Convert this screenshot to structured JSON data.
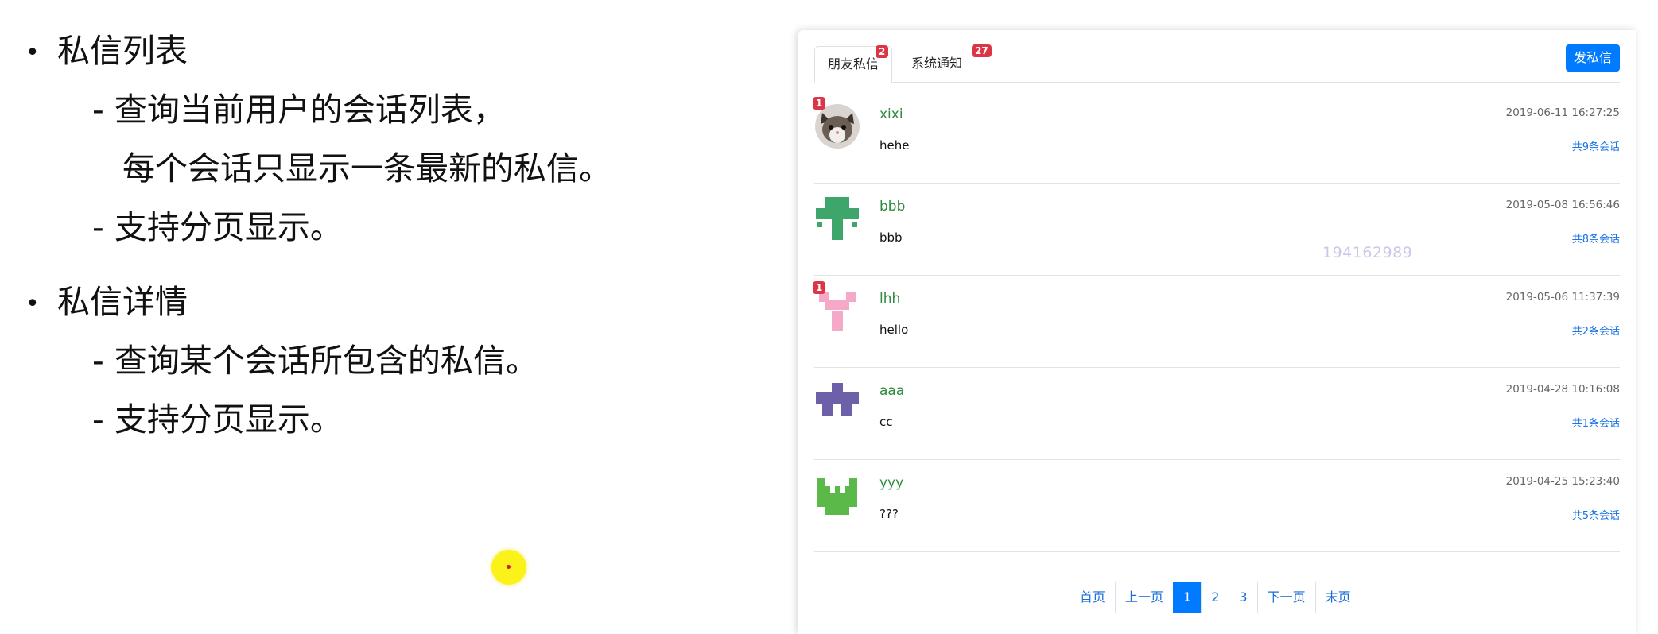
{
  "slide": {
    "items": [
      {
        "bullet": "•",
        "title": "私信列表",
        "subs": [
          "- 查询当前用户的会话列表，",
          "每个会话只显示一条最新的私信。",
          "- 支持分页显示。"
        ]
      },
      {
        "bullet": "•",
        "title": "私信详情",
        "subs": [
          "- 查询某个会话所包含的私信。",
          "- 支持分页显示。"
        ]
      }
    ]
  },
  "panel": {
    "tabs": [
      {
        "label": "朋友私信",
        "badge": "2"
      },
      {
        "label": "系统通知",
        "badge": "27"
      }
    ],
    "send_button": "发私信",
    "watermark": "194162989",
    "conversations": [
      {
        "user": "xixi",
        "message": "hehe",
        "time": "2019-06-11 16:27:25",
        "count": "共9条会话",
        "unread": "1",
        "avatar": "cat-photo"
      },
      {
        "user": "bbb",
        "message": "bbb",
        "time": "2019-05-08 16:56:46",
        "count": "共8条会话",
        "unread": "",
        "avatar": "identicon-green"
      },
      {
        "user": "lhh",
        "message": "hello",
        "time": "2019-05-06 11:37:39",
        "count": "共2条会话",
        "unread": "1",
        "avatar": "identicon-pink"
      },
      {
        "user": "aaa",
        "message": "cc",
        "time": "2019-04-28 10:16:08",
        "count": "共1条会话",
        "unread": "",
        "avatar": "identicon-purple"
      },
      {
        "user": "yyy",
        "message": "???",
        "time": "2019-04-25 15:23:40",
        "count": "共5条会话",
        "unread": "",
        "avatar": "identicon-lime"
      }
    ],
    "pagination": [
      "首页",
      "上一页",
      "1",
      "2",
      "3",
      "下一页",
      "末页"
    ],
    "active_page": "1"
  },
  "colors": {
    "accent": "#007bff",
    "badge": "#dc3545",
    "username": "#2e8b3d",
    "link": "#1a73e8"
  }
}
